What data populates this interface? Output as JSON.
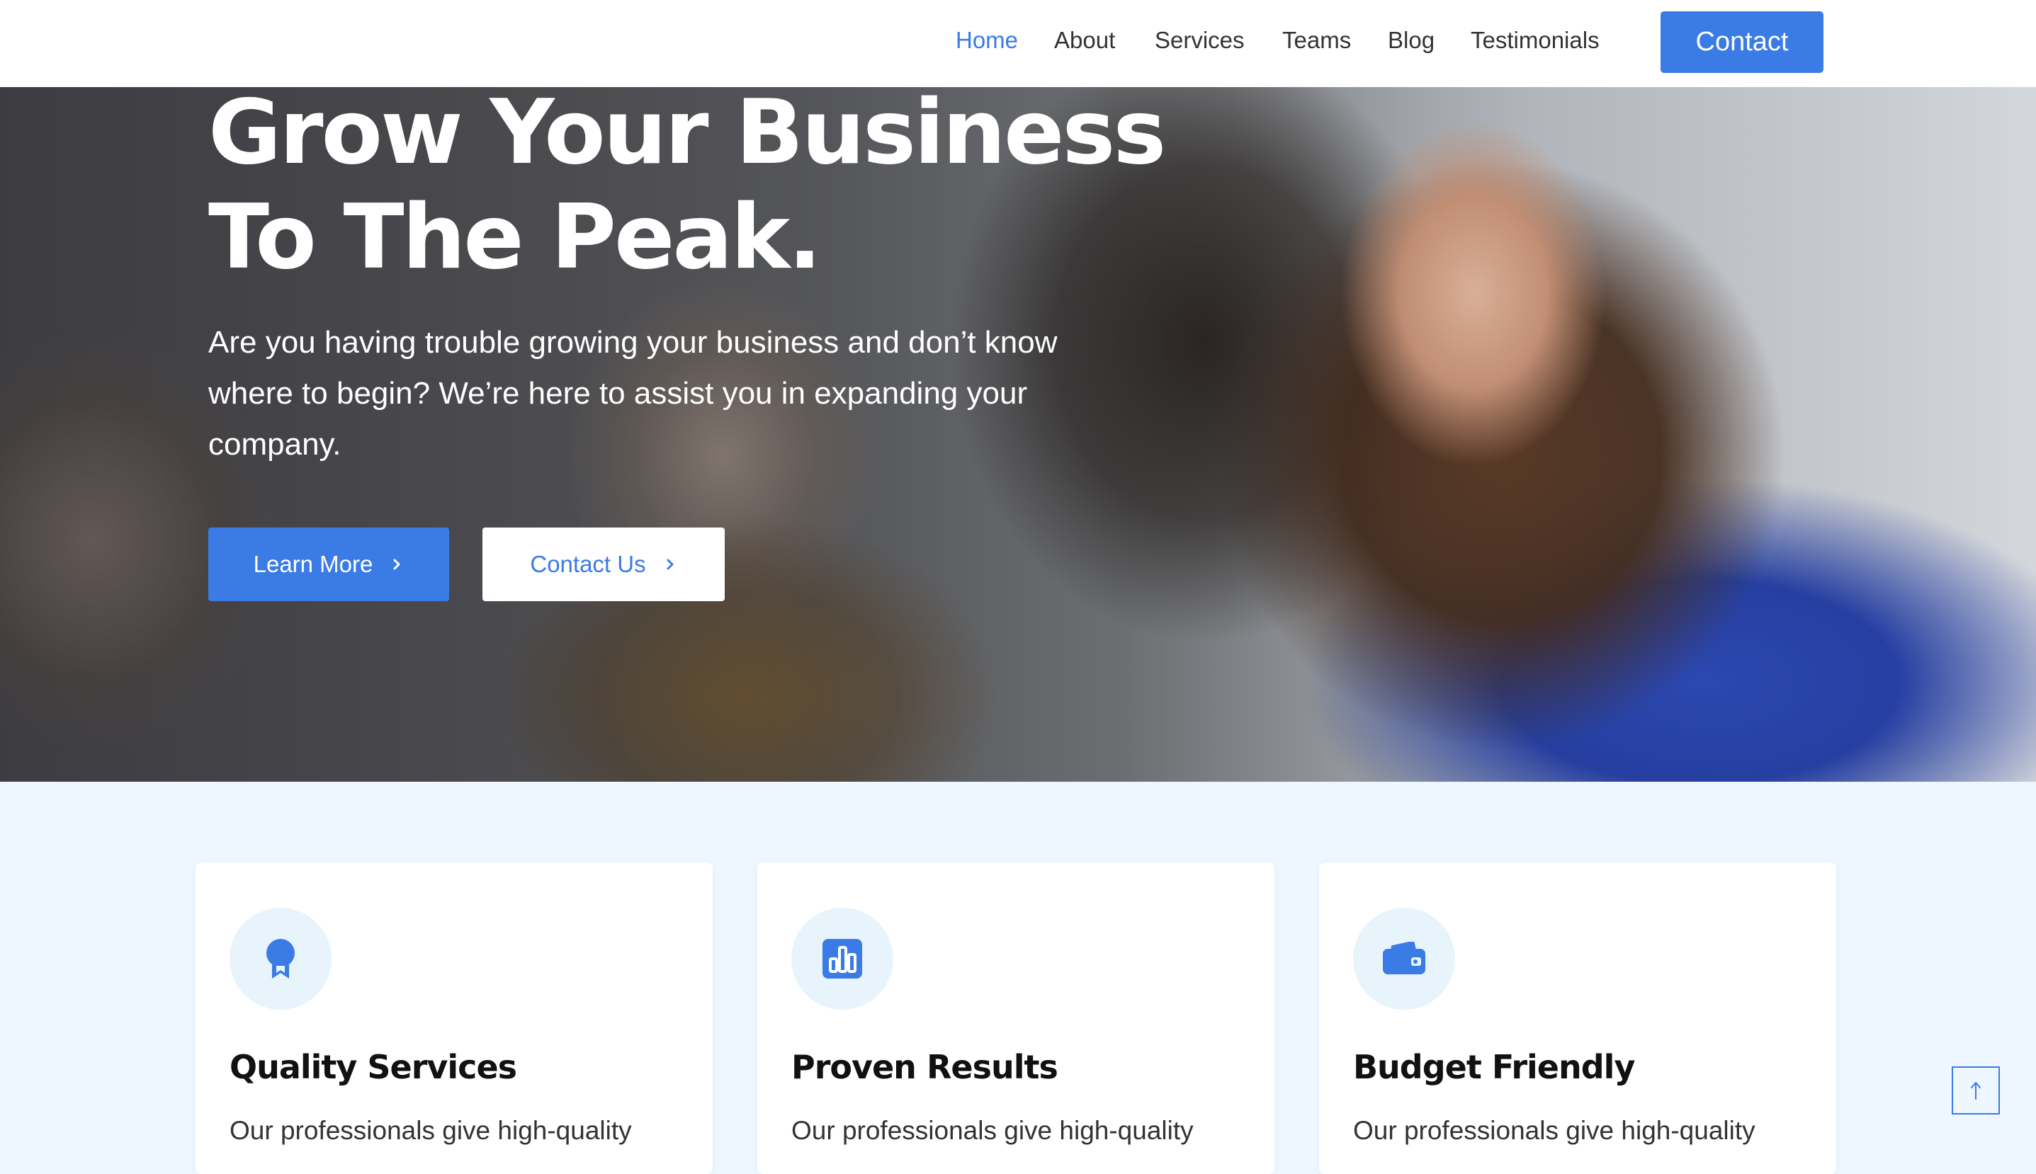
{
  "nav": {
    "links": [
      {
        "label": "Home",
        "active": true
      },
      {
        "label": "About"
      },
      {
        "label": "Services"
      },
      {
        "label": "Teams"
      },
      {
        "label": "Blog"
      },
      {
        "label": "Testimonials"
      }
    ],
    "contact_label": "Contact"
  },
  "hero": {
    "title_line1": "Grow Your Business",
    "title_line2": "To The Peak.",
    "description": "Are you having trouble growing your business and don’t know where to begin? We’re here to assist you in expanding your company.",
    "primary_button": "Learn More",
    "secondary_button": "Contact Us",
    "image": "smiling woman in blue top with colleagues (blurred background)"
  },
  "features": [
    {
      "icon": "award-icon",
      "title": "Quality Services",
      "text": "Our professionals give high-quality"
    },
    {
      "icon": "chart-icon",
      "title": "Proven Results",
      "text": "Our professionals give high-quality"
    },
    {
      "icon": "wallet-icon",
      "title": "Budget Friendly",
      "text": "Our professionals give high-quality"
    }
  ],
  "colors": {
    "accent": "#3a7be6",
    "section_bg": "#eef6ff",
    "icon_bg": "#e8f4fc"
  }
}
